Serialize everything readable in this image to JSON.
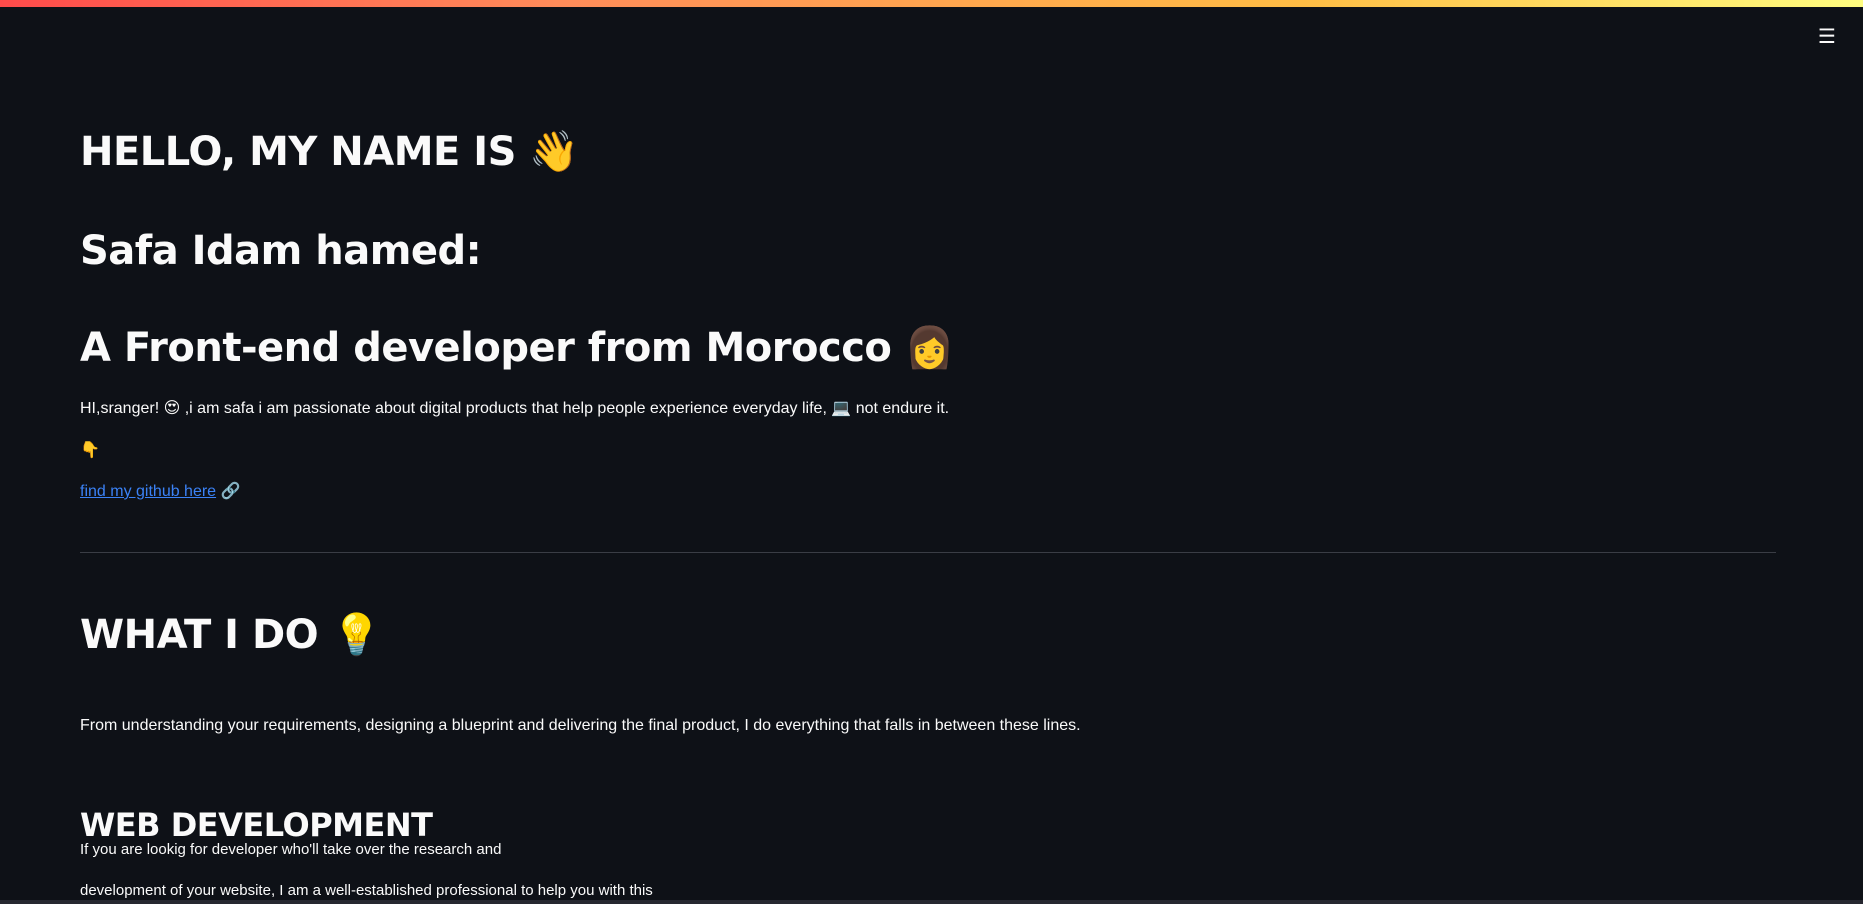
{
  "menu": {
    "icon": "hamburger-menu-icon",
    "glyph": "☰"
  },
  "header": {
    "greeting": "HELLO, MY NAME IS",
    "greeting_emoji": "👋",
    "name": "Safa Idam hamed:",
    "role": "A Front-end developer from Morocco",
    "role_emoji": "👩"
  },
  "intro": {
    "text_start": "HI,sranger! ",
    "emoji_1": "😍",
    "text_mid": " ,i am safa i am passionate about digital products that help people experience everyday life, ",
    "emoji_2": "💻",
    "text_end": " not endure it.",
    "pointer_emoji": "👇"
  },
  "github": {
    "link_text": "find my github here",
    "link_emoji": "🔗"
  },
  "what_i_do": {
    "title": "WHAT I DO",
    "title_emoji": "💡",
    "description": "From understanding your requirements, designing a blueprint and delivering the final product, I do everything that falls in between these lines."
  },
  "web_dev": {
    "title": "WEB DEVELOPMENT",
    "line1": "If you are lookig for developer who'll take over the research and",
    "line2": "development of your website, I am a well-established professional to help you with this"
  },
  "colors": {
    "background": "#0e1117",
    "text": "#fafafa",
    "link": "#3b82f6",
    "divider": "#3a3d45"
  }
}
